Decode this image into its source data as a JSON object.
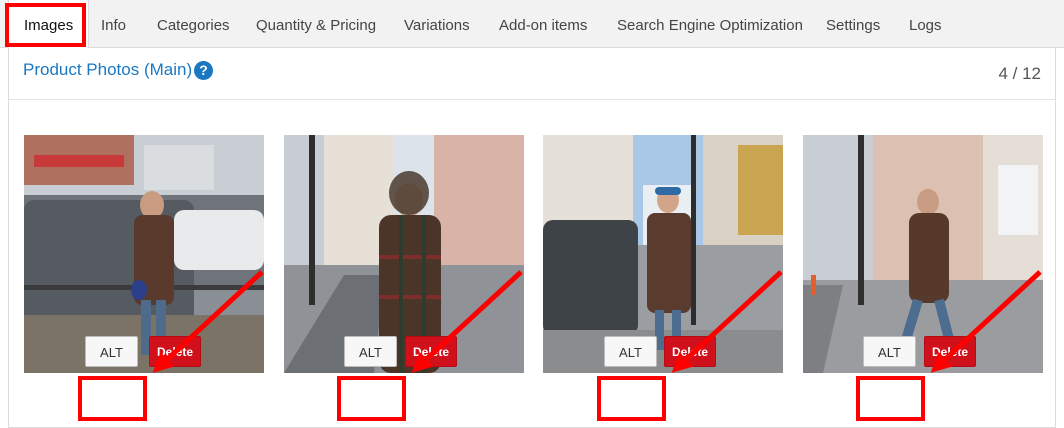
{
  "tabs": [
    {
      "label": "Images",
      "active": true
    },
    {
      "label": "Info"
    },
    {
      "label": "Categories"
    },
    {
      "label": "Quantity & Pricing"
    },
    {
      "label": "Variations"
    },
    {
      "label": "Add-on items"
    },
    {
      "label": "Search Engine Optimization"
    },
    {
      "label": "Settings"
    },
    {
      "label": "Logs"
    }
  ],
  "panel": {
    "title": "Product Photos (Main)",
    "help_icon": "question-circle-icon",
    "count": "4 / 12"
  },
  "photos": [
    {
      "alt_label": "ALT",
      "delete_label": "Delete"
    },
    {
      "alt_label": "ALT",
      "delete_label": "Delete"
    },
    {
      "alt_label": "ALT",
      "delete_label": "Delete"
    },
    {
      "alt_label": "ALT",
      "delete_label": "Delete"
    }
  ],
  "colors": {
    "accent_blue": "#1a78c2",
    "delete_red": "#d0101b",
    "highlight_red": "#ff0000"
  }
}
